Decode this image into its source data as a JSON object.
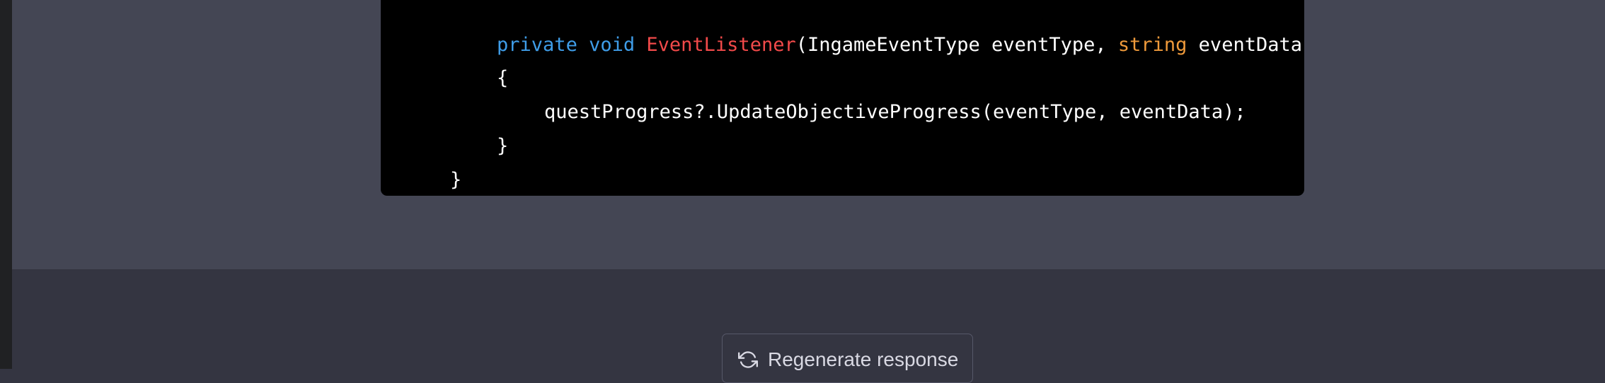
{
  "code": {
    "lines": [
      [
        {
          "text": "private",
          "kind": "kw"
        },
        {
          "text": " ",
          "kind": "plain"
        },
        {
          "text": "void",
          "kind": "kw"
        },
        {
          "text": " ",
          "kind": "plain"
        },
        {
          "text": "EventListener",
          "kind": "fn"
        },
        {
          "text": "(IngameEventType eventType, ",
          "kind": "plain"
        },
        {
          "text": "string",
          "kind": "ty"
        },
        {
          "text": " eventData)",
          "kind": "plain"
        }
      ],
      [
        {
          "text": "{",
          "kind": "plain"
        }
      ],
      [
        {
          "text": "questProgress?.UpdateObjectiveProgress(eventType, eventData);",
          "kind": "plain"
        }
      ],
      [
        {
          "text": "}",
          "kind": "plain"
        }
      ],
      [
        {
          "text": "}",
          "kind": "plain"
        }
      ]
    ]
  },
  "actions": {
    "regenerate_label": "Regenerate response",
    "regenerate_icon": "refresh-icon"
  },
  "colors": {
    "keyword": "#3f9de8",
    "function": "#f24a4a",
    "type": "#ef9a3b",
    "text": "#ffffff",
    "code_bg": "#000000",
    "message_bg": "#444654",
    "page_bg": "#343541"
  }
}
